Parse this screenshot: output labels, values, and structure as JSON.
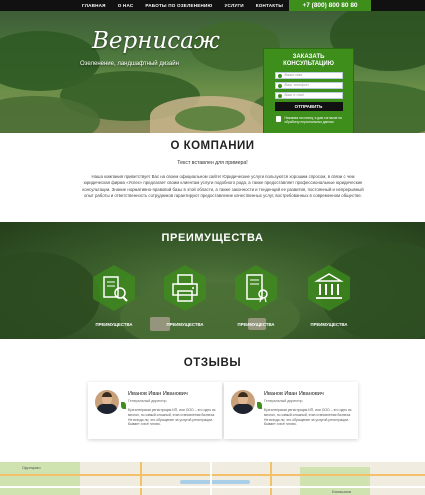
{
  "nav": {
    "items": [
      "ГЛАВНАЯ",
      "О НАС",
      "РАБОТЫ ПО ОЗЕЛЕНЕНИЮ",
      "УСЛУГИ",
      "КОНТАКТЫ"
    ],
    "phone": "+7 (800) 800 80 80"
  },
  "hero": {
    "logo_title": "Вернисаж",
    "logo_subtitle": "Озеленение, ландшафтный дизайн",
    "form": {
      "title_line1": "ЗАКАЗАТЬ",
      "title_line2": "КОНСУЛЬТАЦИЮ",
      "name_placeholder": "Ваше имя",
      "phone_placeholder": "Ваш телефон",
      "email_placeholder": "Ваш e-mail",
      "submit_label": "ОТПРАВИТЬ",
      "agree_text": "Нажимая на кнопку, я даю согласие на обработку персональных данных"
    }
  },
  "about": {
    "title": "О КОМПАНИИ",
    "subtitle": "Текст вставлен для примера!",
    "text": "Наша компания приветствует Вас на своем официальном сайте! Юридические услуги пользуются хорошим спросом, в связи с чем юридическая фирма «Успех» предлагает своим клиентам услуги подобного рода, а также предоставляет профессиональные юридические консультации. Знание нормативно-правовой базы в этой области, а также законности и тенденций ее развития, постоянный и непрерывный опыт работы и ответственность сотрудников гарантируют предоставление качественных услуг, востребованных в современном обществе."
  },
  "advantages": {
    "title": "ПРЕИМУЩЕСТВА",
    "items": [
      {
        "label": "ПРЕИМУЩЕСТВА",
        "icon": "certificate-search-icon"
      },
      {
        "label": "ПРЕИМУЩЕСТВА",
        "icon": "printer-document-icon"
      },
      {
        "label": "ПРЕИМУЩЕСТВА",
        "icon": "signed-contract-icon"
      },
      {
        "label": "ПРЕИМУЩЕСТВА",
        "icon": "bank-building-icon"
      }
    ]
  },
  "reviews": {
    "title": "ОТЗЫВЫ",
    "items": [
      {
        "name": "Иванов Иван Иванович",
        "role": "Генеральный директор",
        "text": "Бухгалтерская регистрация ИП, или ООО – это одно из многих, но самый сложный, этап становления бизнеса. Не всегда ли, это обращение за услугой регистрации. Бывает и всё готово."
      },
      {
        "name": "Иванов Иван Иванович",
        "role": "Генеральный директор",
        "text": "Бухгалтерская регистрация ИП, или ООО – это одно из многих, но самый сложный, этап становления бизнеса. Не всегда ли, это обращение за услугой регистрации. Бывает и всё готово."
      }
    ]
  },
  "map": {
    "labels": [
      "Одинцово",
      "Балашиха"
    ]
  },
  "colors": {
    "accent": "#3e8e1c",
    "nav_bg": "#111111"
  }
}
